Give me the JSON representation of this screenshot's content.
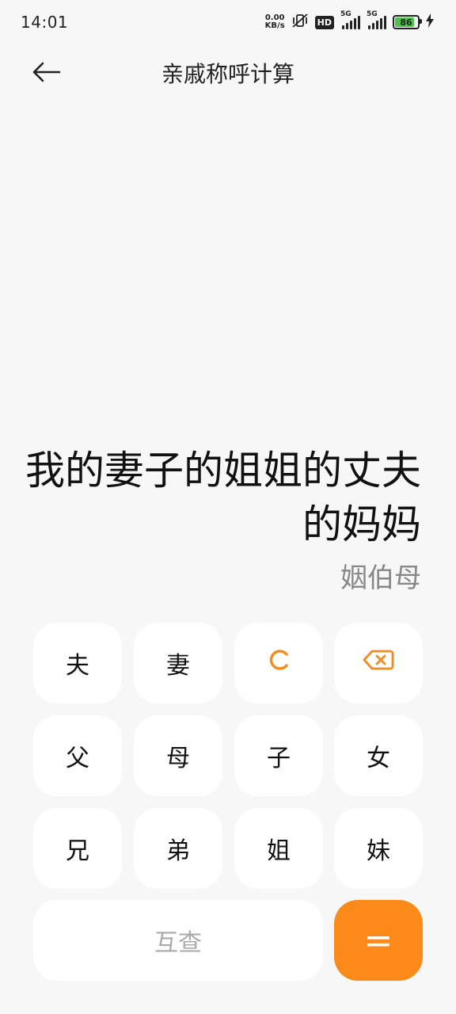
{
  "status": {
    "time": "14:01",
    "net_speed_top": "0.00",
    "net_speed_bottom": "KB/s",
    "hd_label": "HD",
    "signal1_label": "5G",
    "signal2_label": "5G",
    "battery_level": "86"
  },
  "header": {
    "title": "亲戚称呼计算"
  },
  "display": {
    "expression": "我的妻子的姐姐的丈夫的妈妈",
    "result": "姻伯母"
  },
  "keypad": {
    "row1": [
      "夫",
      "妻"
    ],
    "row2": [
      "父",
      "母",
      "子",
      "女"
    ],
    "row3": [
      "兄",
      "弟",
      "姐",
      "妹"
    ],
    "mutual_label": "互查",
    "equals_label": "="
  },
  "colors": {
    "accent": "#fb8a1b",
    "accent_text": "#f58b1f",
    "background": "#f7f7f7"
  }
}
